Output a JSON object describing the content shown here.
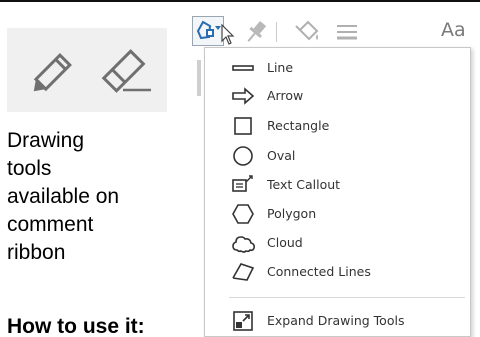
{
  "caption": {
    "lines": [
      "Drawing",
      "tools",
      "available on",
      "comment",
      "ribbon"
    ]
  },
  "how_to": "How to use it:",
  "toolbar": {
    "font_button_label": "Aa",
    "icons": [
      "drawing-shapes-icon",
      "pin-icon",
      "fill-color-icon",
      "line-style-icon",
      "font-icon"
    ]
  },
  "menu": {
    "items": [
      {
        "label": "Line",
        "icon": "line-icon"
      },
      {
        "label": "Arrow",
        "icon": "arrow-icon"
      },
      {
        "label": "Rectangle",
        "icon": "rectangle-icon"
      },
      {
        "label": "Oval",
        "icon": "oval-icon"
      },
      {
        "label": "Text Callout",
        "icon": "text-callout-icon"
      },
      {
        "label": "Polygon",
        "icon": "polygon-icon"
      },
      {
        "label": "Cloud",
        "icon": "cloud-icon"
      },
      {
        "label": "Connected Lines",
        "icon": "connected-lines-icon"
      }
    ],
    "footer_item": {
      "label": "Expand Drawing Tools",
      "icon": "expand-drawing-tools-icon"
    }
  },
  "colors": {
    "accent": "#2b6cb0",
    "icon_gray": "#707070",
    "panel_bg": "#f0f0f0"
  }
}
